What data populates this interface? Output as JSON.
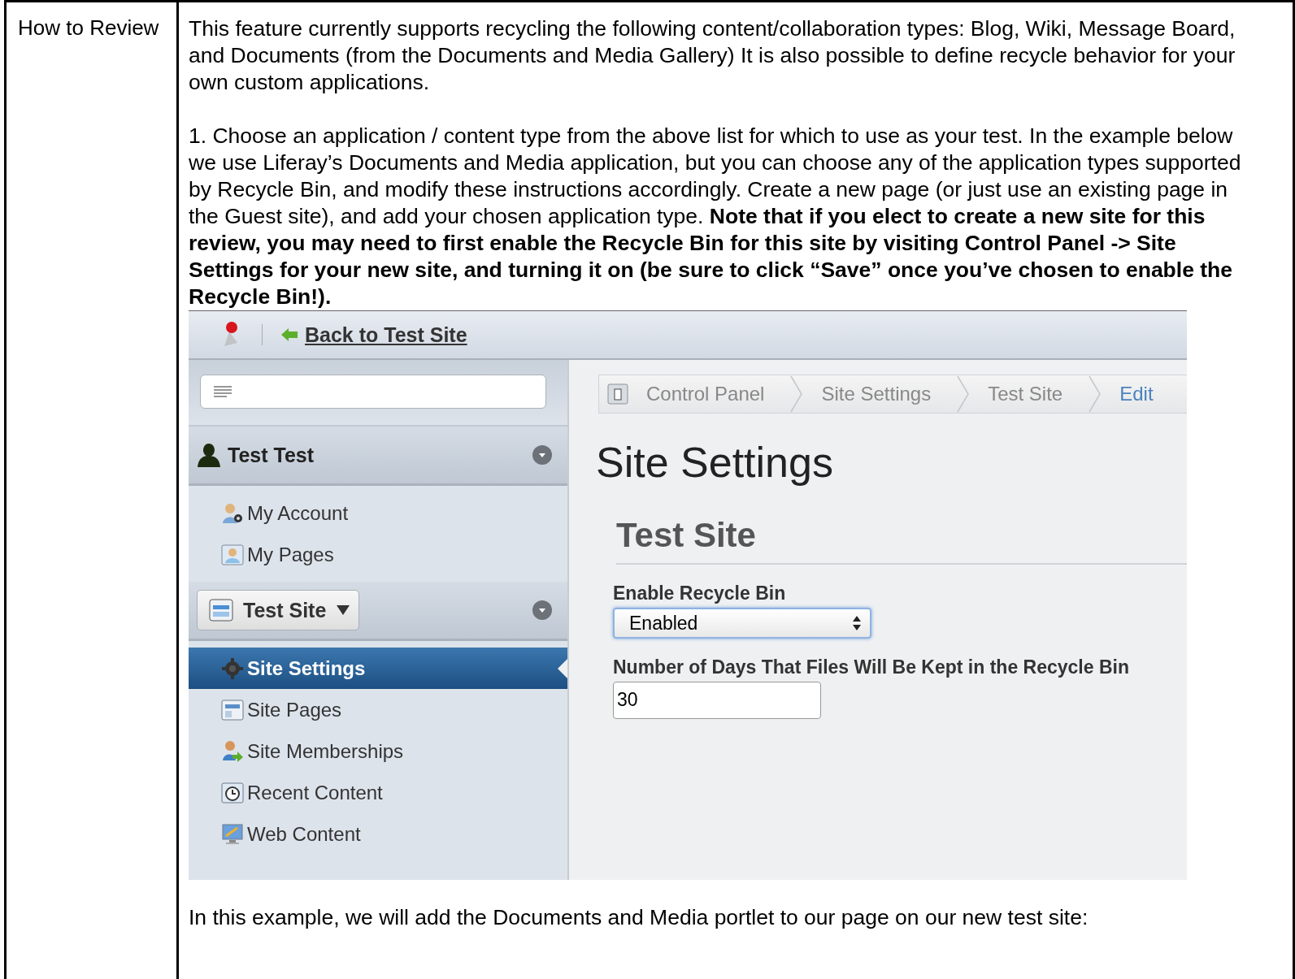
{
  "row_label": "How to Review",
  "intro_paragraph": "This feature currently supports recycling the following content/collaboration types: Blog, Wiki, Message Board, and Documents (from the Documents and Media Gallery)  It is also possible to define recycle behavior for your own custom applications.",
  "step_paragraph": "1. Choose an application / content type from the above list for which to use as your test.  In the example below we use Liferay’s Documents and Media application, but you can choose any of the application types supported by Recycle Bin, and modify these instructions accordingly.  Create a new page (or just use an existing page in the Guest site), and add your chosen application type.  **Note that if you elect to create a new site for this review, you may need to first enable the Recycle Bin for this site by visiting Control Panel -> Site Settings for your new site, and turning it on (be sure to click “Save” once you’ve chosen to enable the Recycle Bin!).**",
  "screenshot": {
    "back_link": "Back to Test Site",
    "user_name": "Test Test",
    "user_items": [
      {
        "label": "My Account",
        "kind": "account",
        "selected": false
      },
      {
        "label": "My Pages",
        "kind": "pages",
        "selected": false
      }
    ],
    "site_button": "Test Site",
    "site_items": [
      {
        "label": "Site Settings",
        "kind": "settings",
        "selected": true
      },
      {
        "label": "Site Pages",
        "kind": "site-pages",
        "selected": false
      },
      {
        "label": "Site Memberships",
        "kind": "members",
        "selected": false
      },
      {
        "label": "Recent Content",
        "kind": "recent",
        "selected": false
      },
      {
        "label": "Web Content",
        "kind": "web",
        "selected": false
      }
    ],
    "breadcrumb": [
      {
        "label": "Control Panel",
        "selected": false
      },
      {
        "label": "Site Settings",
        "selected": false
      },
      {
        "label": "Test Site",
        "selected": false
      },
      {
        "label": "Edit",
        "selected": true
      }
    ],
    "page_title": "Site Settings",
    "section_title": "Test Site",
    "fields": [
      {
        "kind": "select",
        "label": "Enable Recycle Bin",
        "value": "Enabled"
      },
      {
        "kind": "text",
        "label": "Number of Days That Files Will Be Kept in the Recycle Bin",
        "value": "30"
      }
    ]
  },
  "closing_paragraph": "In this example, we will add the Documents and Media portlet to our page on our new test site:"
}
